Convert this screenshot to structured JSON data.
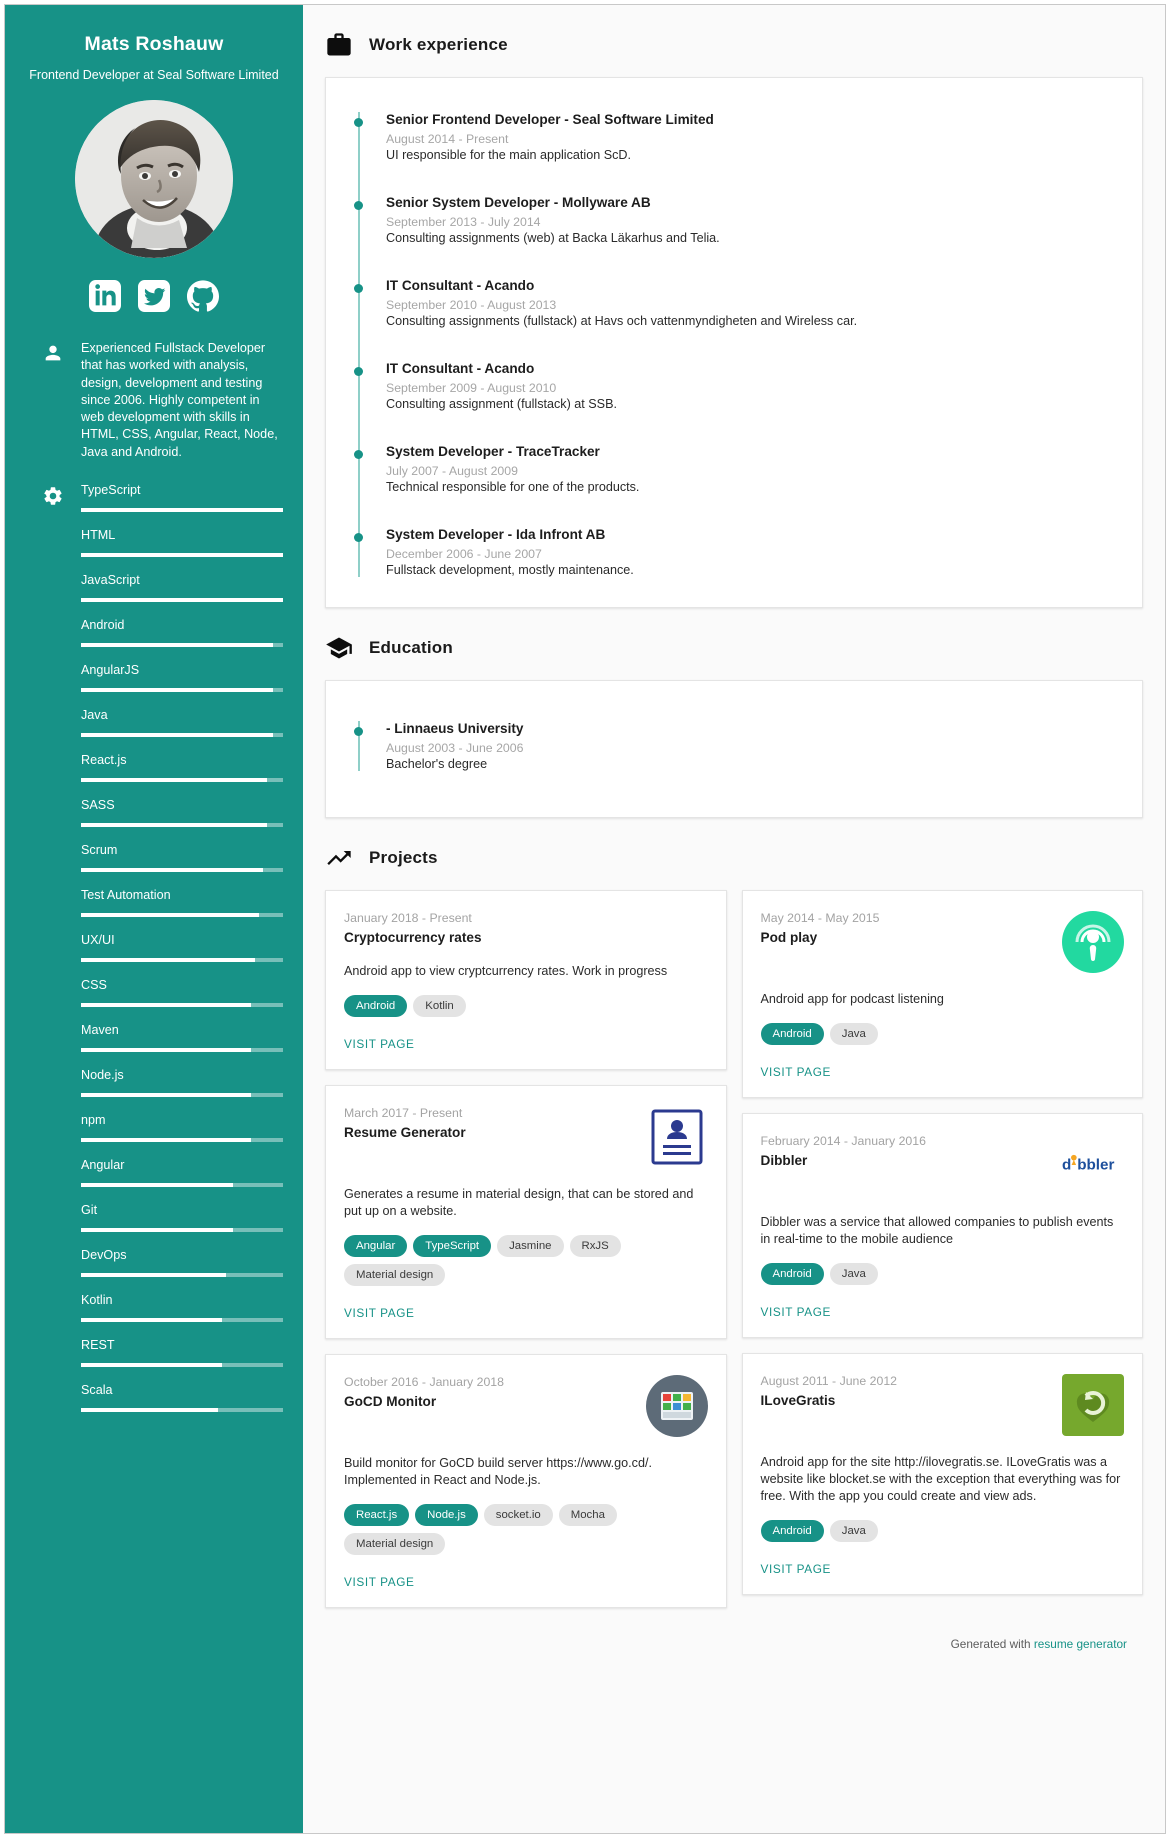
{
  "sidebar": {
    "name": "Mats Roshauw",
    "subtitle": "Frontend Developer at Seal Software Limited",
    "avatar_alt": "profile-photo",
    "socials": [
      {
        "name": "linkedin-icon"
      },
      {
        "name": "twitter-icon"
      },
      {
        "name": "github-icon"
      }
    ],
    "about_icon": "person-icon",
    "about": "Experienced Fullstack Developer that has worked with analysis, design, development and testing since 2006. Highly competent in web development with skills in HTML, CSS, Angular, React, Node, Java and Android.",
    "skills_icon": "gear-icon",
    "skills": [
      {
        "label": "TypeScript",
        "level": 100
      },
      {
        "label": "HTML",
        "level": 100
      },
      {
        "label": "JavaScript",
        "level": 100
      },
      {
        "label": "Android",
        "level": 95
      },
      {
        "label": "AngularJS",
        "level": 95
      },
      {
        "label": "Java",
        "level": 95
      },
      {
        "label": "React.js",
        "level": 92
      },
      {
        "label": "SASS",
        "level": 92
      },
      {
        "label": "Scrum",
        "level": 90
      },
      {
        "label": "Test Automation",
        "level": 88
      },
      {
        "label": "UX/UI",
        "level": 86
      },
      {
        "label": "CSS",
        "level": 84
      },
      {
        "label": "Maven",
        "level": 84
      },
      {
        "label": "Node.js",
        "level": 84
      },
      {
        "label": "npm",
        "level": 84
      },
      {
        "label": "Angular",
        "level": 75
      },
      {
        "label": "Git",
        "level": 75
      },
      {
        "label": "DevOps",
        "level": 72
      },
      {
        "label": "Kotlin",
        "level": 70
      },
      {
        "label": "REST",
        "level": 70
      },
      {
        "label": "Scala",
        "level": 68
      }
    ]
  },
  "work": {
    "icon": "briefcase-icon",
    "title": "Work experience",
    "items": [
      {
        "title": "Senior Frontend Developer - Seal Software Limited",
        "date": "August 2014 - Present",
        "desc": "UI responsible for the main application ScD."
      },
      {
        "title": "Senior System Developer - Mollyware AB",
        "date": "September 2013 - July 2014",
        "desc": "Consulting assignments (web) at Backa Läkarhus and Telia."
      },
      {
        "title": "IT Consultant - Acando",
        "date": "September 2010 - August 2013",
        "desc": "Consulting assignments (fullstack) at Havs och vattenmyndigheten and Wireless car."
      },
      {
        "title": "IT Consultant - Acando",
        "date": "September 2009 - August 2010",
        "desc": "Consulting assignment (fullstack) at SSB."
      },
      {
        "title": "System Developer - TraceTracker",
        "date": "July 2007 - August 2009",
        "desc": "Technical responsible for one of the products."
      },
      {
        "title": "System Developer - Ida Infront AB",
        "date": "December 2006 - June 2007",
        "desc": "Fullstack development, mostly maintenance."
      }
    ]
  },
  "education": {
    "icon": "graduation-cap-icon",
    "title": "Education",
    "items": [
      {
        "title": "- Linnaeus University",
        "date": "August 2003 - June 2006",
        "desc": "Bachelor's degree"
      }
    ]
  },
  "projects": {
    "icon": "trending-up-icon",
    "title": "Projects",
    "visit_label": "VISIT PAGE",
    "items": [
      {
        "column": "left",
        "date": "January 2018 - Present",
        "title": "Cryptocurrency rates",
        "desc": "Android app to view cryptcurrency rates. Work in progress",
        "logo": "none",
        "tags": [
          {
            "label": "Android",
            "accent": true
          },
          {
            "label": "Kotlin",
            "accent": false
          }
        ]
      },
      {
        "column": "left",
        "date": "March 2017 - Present",
        "title": "Resume Generator",
        "desc": "Generates a resume in material design, that can be stored and put up on a website.",
        "logo": "resume-document-icon",
        "tags": [
          {
            "label": "Angular",
            "accent": true
          },
          {
            "label": "TypeScript",
            "accent": true
          },
          {
            "label": "Jasmine",
            "accent": false
          },
          {
            "label": "RxJS",
            "accent": false
          },
          {
            "label": "Material design",
            "accent": false
          }
        ]
      },
      {
        "column": "left",
        "date": "October 2016 - January 2018",
        "title": "GoCD Monitor",
        "desc": "Build monitor for GoCD build server https://www.go.cd/. Implemented in React and Node.js.",
        "logo": "gocd-monitor-icon",
        "tags": [
          {
            "label": "React.js",
            "accent": true
          },
          {
            "label": "Node.js",
            "accent": true
          },
          {
            "label": "socket.io",
            "accent": false
          },
          {
            "label": "Mocha",
            "accent": false
          },
          {
            "label": "Material design",
            "accent": false
          }
        ]
      },
      {
        "column": "right",
        "date": "May 2014 - May 2015",
        "title": "Pod play",
        "desc": "Android app for podcast listening",
        "logo": "podplay-icon",
        "tags": [
          {
            "label": "Android",
            "accent": true
          },
          {
            "label": "Java",
            "accent": false
          }
        ]
      },
      {
        "column": "right",
        "date": "February 2014 - January 2016",
        "title": "Dibbler",
        "desc": "Dibbler was a service that allowed companies to publish events in real-time to the mobile audience",
        "logo": "dibbler-icon",
        "tags": [
          {
            "label": "Android",
            "accent": true
          },
          {
            "label": "Java",
            "accent": false
          }
        ]
      },
      {
        "column": "right",
        "date": "August 2011 - June 2012",
        "title": "ILoveGratis",
        "desc": "Android app for the site http://ilovegratis.se. ILoveGratis was a website like blocket.se with the exception that everything was for free. With the app you could create and view ads.",
        "logo": "ilovegratis-icon",
        "tags": [
          {
            "label": "Android",
            "accent": true
          },
          {
            "label": "Java",
            "accent": false
          }
        ]
      }
    ]
  },
  "footer": {
    "text": "Generated with ",
    "link": "resume generator"
  },
  "colors": {
    "accent": "#179287",
    "sidebar_bg": "#179287",
    "page_bg": "#fafafa",
    "tag_bg": "#e3e3e3",
    "muted_text": "#a3a3a3"
  }
}
